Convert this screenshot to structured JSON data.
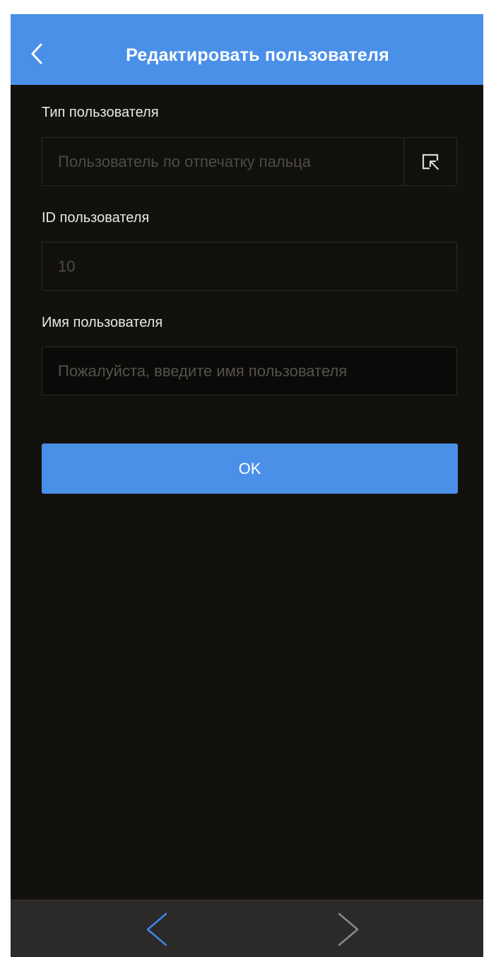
{
  "header": {
    "title": "Редактировать пользователя",
    "back_icon": "chevron-left-icon"
  },
  "form": {
    "user_type": {
      "label": "Тип пользователя",
      "value": "Пользователь по отпечатку пальца",
      "select_icon": "select-cursor-icon"
    },
    "user_id": {
      "label": "ID пользователя",
      "value": "10"
    },
    "user_name": {
      "label": "Имя пользователя",
      "placeholder": "Пожалуйста, введите имя пользователя"
    },
    "ok_label": "OK"
  },
  "bottom_nav": {
    "back_icon": "chevron-left-icon",
    "forward_icon": "chevron-right-icon"
  },
  "colors": {
    "accent": "#4a90e8",
    "background": "#13110e",
    "bottom_bar": "#2b2a28"
  }
}
